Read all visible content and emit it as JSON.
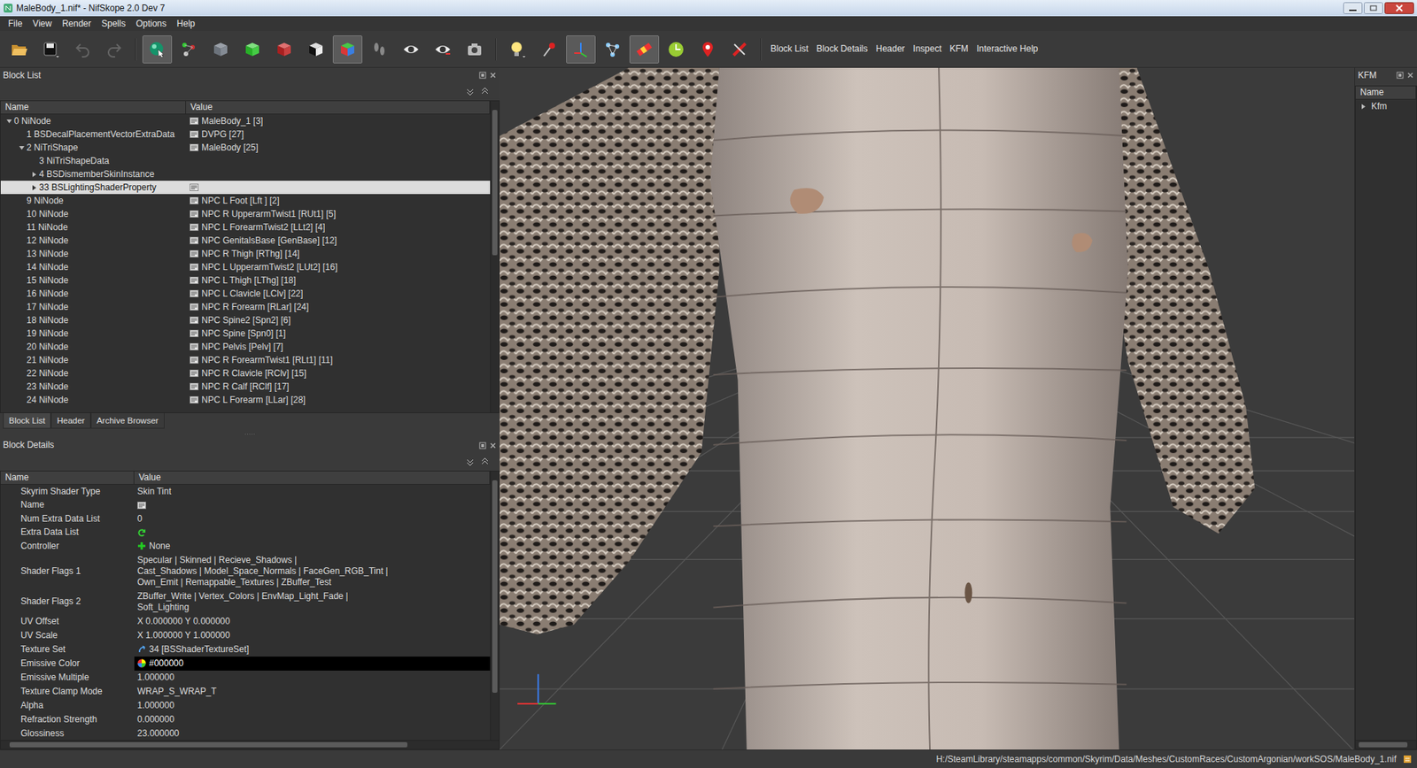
{
  "window": {
    "title": "MaleBody_1.nif* - NifSkope 2.0 Dev 7"
  },
  "menu": [
    "File",
    "View",
    "Render",
    "Spells",
    "Options",
    "Help"
  ],
  "toolbar": {
    "tools": [
      {
        "checked": false,
        "disabled": false
      },
      {
        "checked": false,
        "disabled": false
      },
      {
        "checked": false,
        "disabled": true
      },
      {
        "checked": false,
        "disabled": true
      },
      {
        "checked": true,
        "disabled": false
      },
      {
        "checked": false,
        "disabled": false
      },
      {
        "checked": false,
        "disabled": false
      },
      {
        "checked": false,
        "disabled": false
      },
      {
        "checked": false,
        "disabled": false
      },
      {
        "checked": false,
        "disabled": false
      },
      {
        "checked": true,
        "disabled": false
      },
      {
        "checked": false,
        "disabled": false
      },
      {
        "checked": false,
        "disabled": false
      },
      {
        "checked": false,
        "disabled": false
      },
      {
        "checked": false,
        "disabled": false
      },
      {
        "checked": false,
        "disabled": false
      },
      {
        "checked": false,
        "disabled": false
      },
      {
        "checked": true,
        "disabled": false
      },
      {
        "checked": false,
        "disabled": false
      },
      {
        "checked": true,
        "disabled": false
      },
      {
        "checked": false,
        "disabled": false
      },
      {
        "checked": false,
        "disabled": false
      },
      {
        "checked": false,
        "disabled": false
      }
    ],
    "panel_buttons": [
      "Block List",
      "Block Details",
      "Header",
      "Inspect",
      "KFM",
      "Interactive Help"
    ]
  },
  "block_list": {
    "title": "Block List",
    "columns": [
      "Name",
      "Value"
    ],
    "tree": [
      {
        "name": "0 NiNode",
        "value": "MaleBody_1 [3]",
        "has_icon": true,
        "expandable": true,
        "expanded": true,
        "selected": false,
        "children": [
          {
            "name": "1 BSDecalPlacementVectorExtraData",
            "value": "DVPG [27]",
            "has_icon": true,
            "expandable": false,
            "expanded": false,
            "selected": false,
            "children": []
          },
          {
            "name": "2 NiTriShape",
            "value": "MaleBody [25]",
            "has_icon": true,
            "expandable": true,
            "expanded": true,
            "selected": false,
            "children": [
              {
                "name": "3 NiTriShapeData",
                "value": "",
                "has_icon": false,
                "expandable": false,
                "expanded": false,
                "selected": false,
                "children": []
              },
              {
                "name": "4 BSDismemberSkinInstance",
                "value": "",
                "has_icon": false,
                "expandable": true,
                "expanded": false,
                "selected": false,
                "children": []
              },
              {
                "name": "33 BSLightingShaderProperty",
                "value": "",
                "has_icon": true,
                "expandable": true,
                "expanded": false,
                "selected": true,
                "children": []
              }
            ]
          },
          {
            "name": "9 NiNode",
            "value": "NPC L Foot [Lft ] [2]",
            "has_icon": true,
            "expandable": false,
            "expanded": false,
            "selected": false,
            "children": []
          },
          {
            "name": "10 NiNode",
            "value": "NPC R UpperarmTwist1 [RUt1] [5]",
            "has_icon": true,
            "expandable": false,
            "expanded": false,
            "selected": false,
            "children": []
          },
          {
            "name": "11 NiNode",
            "value": "NPC L ForearmTwist2 [LLt2] [4]",
            "has_icon": true,
            "expandable": false,
            "expanded": false,
            "selected": false,
            "children": []
          },
          {
            "name": "12 NiNode",
            "value": "NPC GenitalsBase [GenBase] [12]",
            "has_icon": true,
            "expandable": false,
            "expanded": false,
            "selected": false,
            "children": []
          },
          {
            "name": "13 NiNode",
            "value": "NPC R Thigh [RThg] [14]",
            "has_icon": true,
            "expandable": false,
            "expanded": false,
            "selected": false,
            "children": []
          },
          {
            "name": "14 NiNode",
            "value": "NPC L UpperarmTwist2 [LUt2] [16]",
            "has_icon": true,
            "expandable": false,
            "expanded": false,
            "selected": false,
            "children": []
          },
          {
            "name": "15 NiNode",
            "value": "NPC L Thigh [LThg] [18]",
            "has_icon": true,
            "expandable": false,
            "expanded": false,
            "selected": false,
            "children": []
          },
          {
            "name": "16 NiNode",
            "value": "NPC L Clavicle [LClv] [22]",
            "has_icon": true,
            "expandable": false,
            "expanded": false,
            "selected": false,
            "children": []
          },
          {
            "name": "17 NiNode",
            "value": "NPC R Forearm [RLar] [24]",
            "has_icon": true,
            "expandable": false,
            "expanded": false,
            "selected": false,
            "children": []
          },
          {
            "name": "18 NiNode",
            "value": "NPC Spine2 [Spn2] [6]",
            "has_icon": true,
            "expandable": false,
            "expanded": false,
            "selected": false,
            "children": []
          },
          {
            "name": "19 NiNode",
            "value": "NPC Spine [Spn0] [1]",
            "has_icon": true,
            "expandable": false,
            "expanded": false,
            "selected": false,
            "children": []
          },
          {
            "name": "20 NiNode",
            "value": "NPC Pelvis [Pelv] [7]",
            "has_icon": true,
            "expandable": false,
            "expanded": false,
            "selected": false,
            "children": []
          },
          {
            "name": "21 NiNode",
            "value": "NPC R ForearmTwist1 [RLt1] [11]",
            "has_icon": true,
            "expandable": false,
            "expanded": false,
            "selected": false,
            "children": []
          },
          {
            "name": "22 NiNode",
            "value": "NPC R Clavicle [RClv] [15]",
            "has_icon": true,
            "expandable": false,
            "expanded": false,
            "selected": false,
            "children": []
          },
          {
            "name": "23 NiNode",
            "value": "NPC R Calf [RClf] [17]",
            "has_icon": true,
            "expandable": false,
            "expanded": false,
            "selected": false,
            "children": []
          },
          {
            "name": "24 NiNode",
            "value": "NPC L Forearm [LLar] [28]",
            "has_icon": true,
            "expandable": false,
            "expanded": false,
            "selected": false,
            "children": []
          }
        ]
      }
    ],
    "scrollbar": {
      "level": 0.52
    },
    "tabs": [
      {
        "label": "Block List",
        "selected": true
      },
      {
        "label": "Header",
        "selected": false
      },
      {
        "label": "Archive Browser",
        "selected": false
      }
    ]
  },
  "block_details": {
    "title": "Block Details",
    "columns": [
      "Name",
      "Value"
    ],
    "rows": [
      {
        "name": "Skyrim Shader Type",
        "kind": "text",
        "value": [
          "Skin Tint"
        ]
      },
      {
        "name": "Name",
        "kind": "txt",
        "value": []
      },
      {
        "name": "Num Extra Data List",
        "kind": "text",
        "value": [
          "0"
        ]
      },
      {
        "name": "Extra Data List",
        "kind": "refresh",
        "value": []
      },
      {
        "name": "Controller",
        "kind": "plus",
        "value": [
          "None"
        ]
      },
      {
        "name": "Shader Flags 1",
        "kind": "text",
        "value": [
          "Specular | Skinned | Recieve_Shadows |",
          "Cast_Shadows | Model_Space_Normals | FaceGen_RGB_Tint |",
          "Own_Emit | Remappable_Textures | ZBuffer_Test"
        ]
      },
      {
        "name": "Shader Flags 2",
        "kind": "text",
        "value": [
          "ZBuffer_Write | Vertex_Colors | EnvMap_Light_Fade |",
          "Soft_Lighting"
        ]
      },
      {
        "name": "UV Offset",
        "kind": "text",
        "value": [
          "X 0.000000 Y 0.000000"
        ]
      },
      {
        "name": "UV Scale",
        "kind": "text",
        "value": [
          "X 1.000000 Y 1.000000"
        ]
      },
      {
        "name": "Texture Set",
        "kind": "link",
        "value": [
          "34 [BSShaderTextureSet]"
        ]
      },
      {
        "name": "Emissive Color",
        "kind": "color",
        "color": "#000000",
        "value": [
          "#000000"
        ]
      },
      {
        "name": "Emissive Multiple",
        "kind": "text",
        "value": [
          "1.000000"
        ]
      },
      {
        "name": "Texture Clamp Mode",
        "kind": "text",
        "value": [
          "WRAP_S_WRAP_T"
        ]
      },
      {
        "name": "Alpha",
        "kind": "text",
        "value": [
          "1.000000"
        ]
      },
      {
        "name": "Refraction Strength",
        "kind": "text",
        "value": [
          "0.000000"
        ]
      },
      {
        "name": "Glossiness",
        "kind": "text",
        "value": [
          "23.000000"
        ]
      }
    ],
    "scrollbar": {
      "level": 0.86
    },
    "hscrollbar": {
      "level": 0.84
    }
  },
  "kfm": {
    "title": "KFM",
    "columns": [
      "Name"
    ],
    "items": [
      {
        "label": "Kfm",
        "expanded": false
      }
    ],
    "hscrollbar": {
      "level": 0.9
    }
  },
  "status_bar": {
    "path": "H:/SteamLibrary/steamapps/common/Skyrim/Data/Meshes/CustomRaces/CustomArgonian/workSOS/MaleBody_1.nif"
  }
}
